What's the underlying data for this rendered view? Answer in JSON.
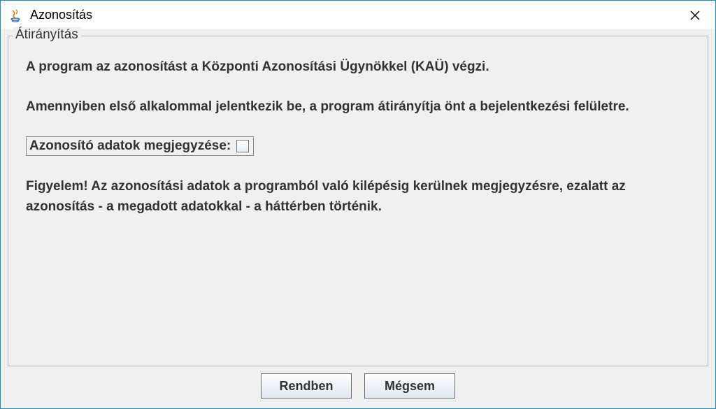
{
  "titlebar": {
    "title": "Azonosítás"
  },
  "fieldset": {
    "legend": "Átirányítás",
    "para1": "A program az azonosítást a Központi Azonosítási Ügynökkel (KAÜ) végzi.",
    "para2": "Amennyiben első alkalommal jelentkezik be, a program átirányítja önt a bejelentkezési felületre.",
    "checkbox_label": "Azonosító adatok megjegyzése:",
    "para3": "Figyelem! Az azonosítási adatok a programból való kilépésig kerülnek megjegyzésre, ezalatt az azonosítás - a megadott adatokkal - a háttérben történik."
  },
  "buttons": {
    "ok": "Rendben",
    "cancel": "Mégsem"
  }
}
